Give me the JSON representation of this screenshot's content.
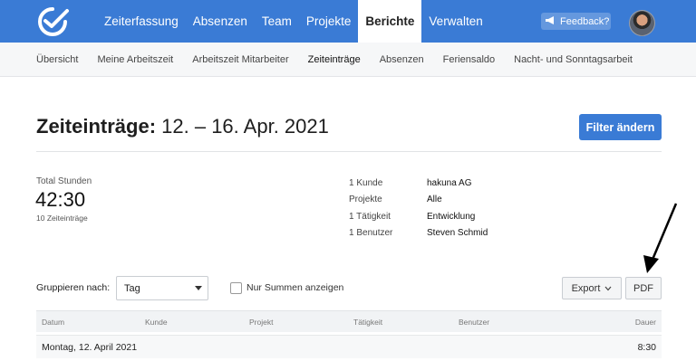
{
  "topnav": {
    "items": [
      {
        "label": "Zeiterfassung",
        "active": false
      },
      {
        "label": "Absenzen",
        "active": false
      },
      {
        "label": "Team",
        "active": false
      },
      {
        "label": "Projekte",
        "active": false
      },
      {
        "label": "Berichte",
        "active": true
      },
      {
        "label": "Verwalten",
        "active": false
      }
    ],
    "feedback_label": "Feedback?",
    "brand_color": "#3a7bd5"
  },
  "subnav": {
    "items": [
      {
        "label": "Übersicht",
        "active": false
      },
      {
        "label": "Meine Arbeitszeit",
        "active": false
      },
      {
        "label": "Arbeitszeit Mitarbeiter",
        "active": false
      },
      {
        "label": "Zeiteinträge",
        "active": true
      },
      {
        "label": "Absenzen",
        "active": false
      },
      {
        "label": "Feriensaldo",
        "active": false
      },
      {
        "label": "Nacht- und Sonntagsarbeit",
        "active": false
      }
    ]
  },
  "page": {
    "title_bold": "Zeiteinträge:",
    "title_range": "12. – 16. Apr. 2021",
    "filter_button": "Filter ändern"
  },
  "summary": {
    "total_label": "Total Stunden",
    "total_value": "42:30",
    "entries_label": "10 Zeiteinträge",
    "meta": [
      {
        "key": "1 Kunde",
        "value": "hakuna AG"
      },
      {
        "key": "Projekte",
        "value": "Alle"
      },
      {
        "key": "1 Tätigkeit",
        "value": "Entwicklung"
      },
      {
        "key": "1 Benutzer",
        "value": "Steven Schmid"
      }
    ]
  },
  "controls": {
    "group_label": "Gruppieren nach:",
    "group_value": "Tag",
    "checkbox_label": "Nur Summen anzeigen",
    "checkbox_checked": false,
    "export_label": "Export",
    "pdf_label": "PDF"
  },
  "table": {
    "headers": [
      "Datum",
      "Kunde",
      "Projekt",
      "Tätigkeit",
      "Benutzer",
      "Dauer"
    ],
    "groups": [
      {
        "label": "Montag, 12. April 2021",
        "total": "8:30"
      }
    ]
  }
}
